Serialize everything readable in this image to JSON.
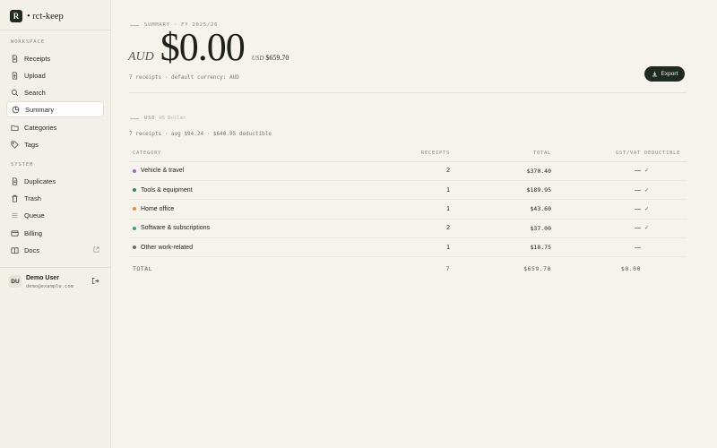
{
  "brand": {
    "logo_letter": "R",
    "name": "• rct-keep"
  },
  "sidebar": {
    "workspace_label": "WORKSPACE",
    "workspace_items": [
      {
        "label": "Receipts",
        "icon": "receipt-icon"
      },
      {
        "label": "Upload",
        "icon": "upload-icon"
      },
      {
        "label": "Search",
        "icon": "search-icon"
      },
      {
        "label": "Summary",
        "icon": "pie-chart-icon",
        "active": true
      },
      {
        "label": "Categories",
        "icon": "folder-icon"
      },
      {
        "label": "Tags",
        "icon": "tag-icon"
      }
    ],
    "system_label": "SYSTEM",
    "system_items": [
      {
        "label": "Duplicates",
        "icon": "copy-icon"
      },
      {
        "label": "Trash",
        "icon": "trash-icon"
      },
      {
        "label": "Queue",
        "icon": "list-icon"
      },
      {
        "label": "Billing",
        "icon": "credit-card-icon"
      },
      {
        "label": "Docs",
        "icon": "book-icon",
        "external": true
      }
    ],
    "user": {
      "initials": "DU",
      "name": "Demo User",
      "email": "demo@example.com"
    }
  },
  "summary": {
    "eyebrow": "SUMMARY · FY 2025/26",
    "currency": "AUD",
    "amount": "$0.00",
    "alt_currency": "USD",
    "alt_amount": "$659.70",
    "receipts_line": "7 receipts · default currency: AUD",
    "export_label": "Export"
  },
  "usd_section": {
    "code": "USD",
    "name": "US Dollar",
    "stats": "7 receipts · avg $94.24 · $640.95 deductible"
  },
  "table": {
    "headers": {
      "category": "CATEGORY",
      "receipts": "RECEIPTS",
      "total": "TOTAL",
      "gst": "GST/VAT",
      "deductible": "DEDUCTIBLE"
    },
    "rows": [
      {
        "category": "Vehicle & travel",
        "color": "#9b6bc9",
        "receipts": "2",
        "total": "$370.40",
        "gst": "—",
        "deductible": "✓"
      },
      {
        "category": "Tools & equipment",
        "color": "#2f8a4e",
        "receipts": "1",
        "total": "$189.95",
        "gst": "—",
        "deductible": "✓"
      },
      {
        "category": "Home office",
        "color": "#e0922f",
        "receipts": "1",
        "total": "$43.60",
        "gst": "—",
        "deductible": "✓"
      },
      {
        "category": "Software & subscriptions",
        "color": "#2aa889",
        "receipts": "2",
        "total": "$37.00",
        "gst": "—",
        "deductible": "✓"
      },
      {
        "category": "Other work-related",
        "color": "#6e6b63",
        "receipts": "1",
        "total": "$18.75",
        "gst": "—",
        "deductible": ""
      }
    ],
    "total": {
      "label": "TOTAL",
      "receipts": "7",
      "total": "$659.70",
      "gst": "$0.00"
    }
  }
}
